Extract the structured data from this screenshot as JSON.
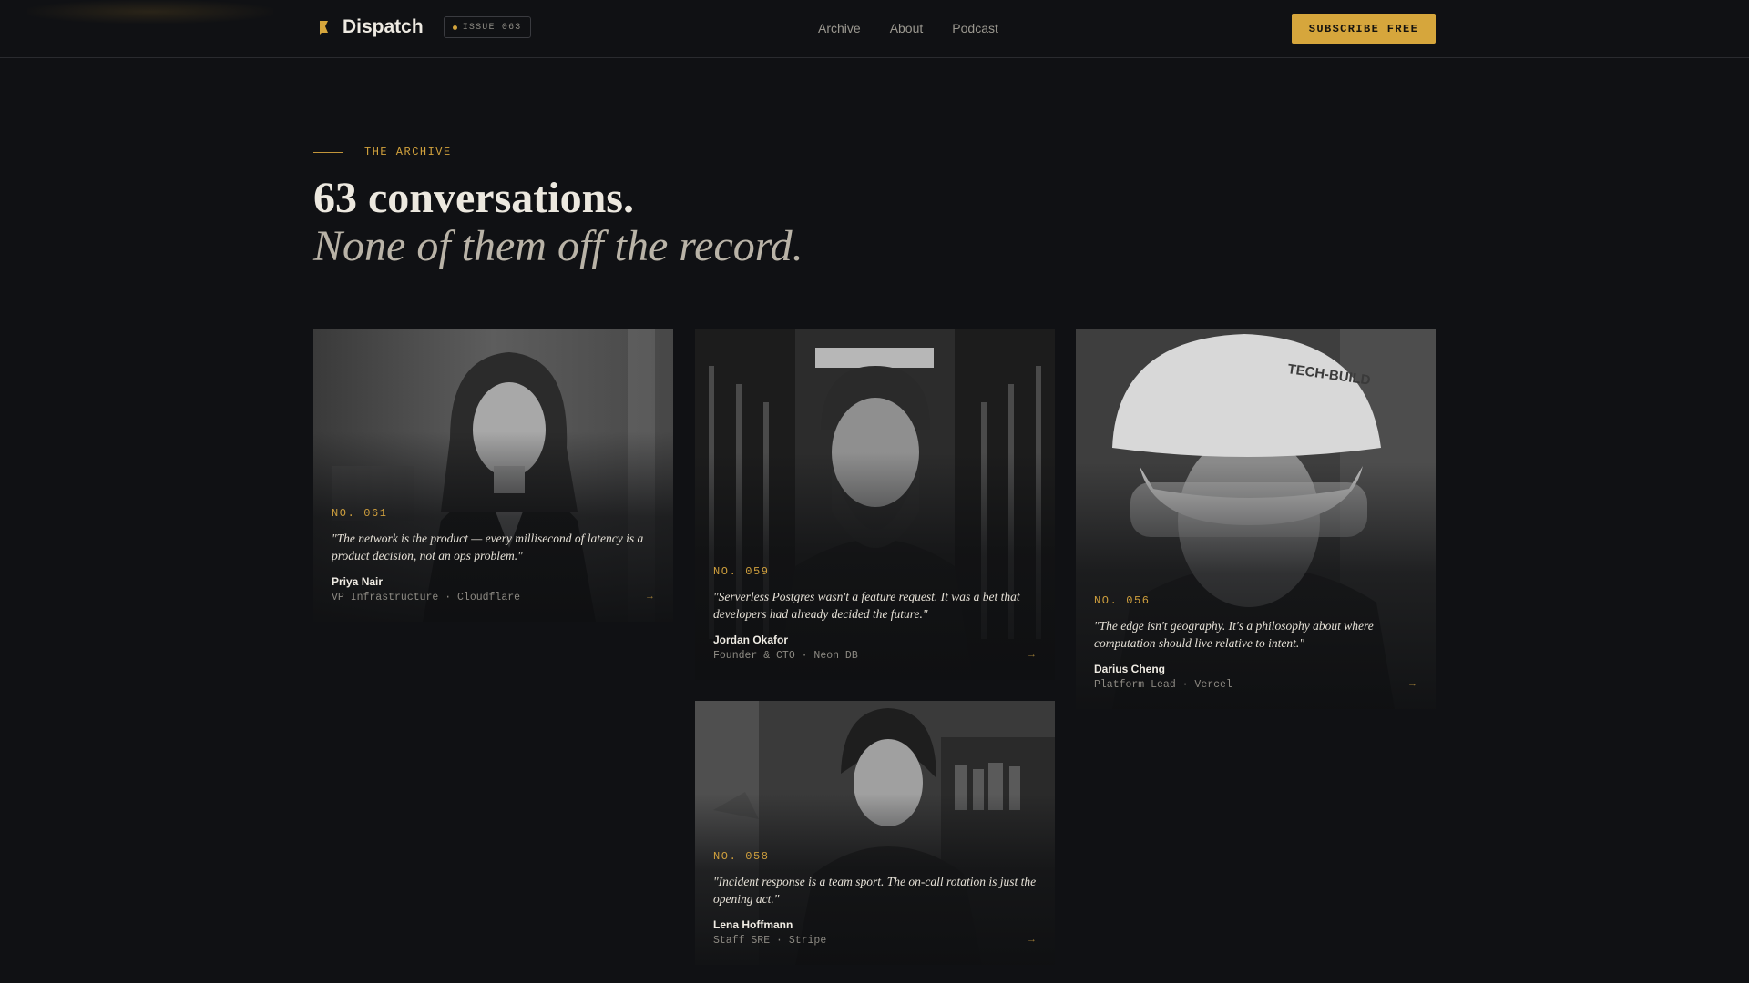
{
  "header": {
    "brand_name": "Dispatch",
    "brand_icon": "bookmark-flag-icon",
    "issue_badge": "ISSUE 063",
    "nav": [
      {
        "label": "Archive"
      },
      {
        "label": "About"
      },
      {
        "label": "Podcast"
      }
    ],
    "subscribe_label": "SUBSCRIBE FREE"
  },
  "hero": {
    "eyebrow": "THE ARCHIVE",
    "title": "63 conversations.",
    "subtitle": "None of them off the record."
  },
  "cards": [
    {
      "number": "NO. 061",
      "quote": "\"The network is the product — every millisecond of latency is a product decision, not an ops problem.\"",
      "name": "Priya Nair",
      "role": "VP Infrastructure · Cloudflare",
      "arrow": "→"
    },
    {
      "number": "NO. 059",
      "quote": "\"Serverless Postgres wasn't a feature request. It was a bet that developers had already decided the future.\"",
      "name": "Jordan Okafor",
      "role": "Founder & CTO · Neon DB",
      "arrow": "→"
    },
    {
      "number": "NO. 056",
      "quote": "\"The edge isn't geography. It's a philosophy about where computation should live relative to intent.\"",
      "name": "Darius Cheng",
      "role": "Platform Lead · Vercel",
      "arrow": "→",
      "helmet_text": "TECH-BUILD"
    },
    {
      "number": "NO. 058",
      "quote": "\"Incident response is a team sport. The on-call rotation is just the opening act.\"",
      "name": "Lena Hoffmann",
      "role": "Staff SRE · Stripe",
      "arrow": "→"
    }
  ],
  "colors": {
    "background": "#101114",
    "accent": "#d6a63c",
    "text": "#ece8df"
  }
}
